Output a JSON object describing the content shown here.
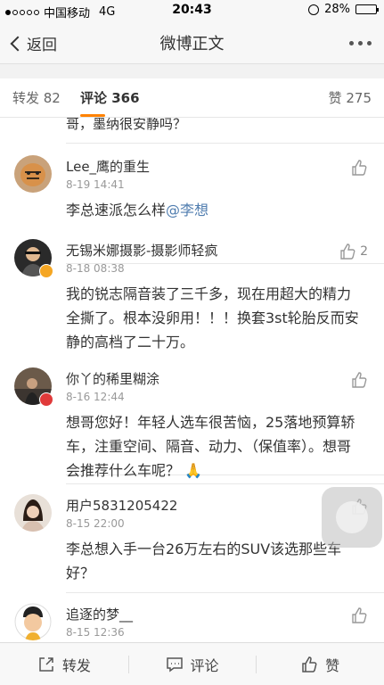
{
  "status_bar": {
    "carrier": "中国移动",
    "network": "4G",
    "time": "20:43",
    "battery": "28%",
    "battery_level": 0.28
  },
  "nav": {
    "back_label": "返回",
    "title": "微博正文"
  },
  "tabs": {
    "repost": "转发 82",
    "comment": "评论 366",
    "like": "赞 275"
  },
  "partial_comment_text": "哥，墨纳很安静吗？",
  "comments": [
    {
      "name": "Lee_鹰的重生",
      "time": "8-19 14:41",
      "text_before": "李总速派怎么样",
      "mention": "@李想",
      "likes": ""
    },
    {
      "name": "无锡米娜摄影-摄影师轻疯",
      "time": "8-18 08:38",
      "text": "我的锐志隔音装了三千多，现在用超大的精力全撕了。根本没卵用！！！换套3st轮胎反而安静的高档了二十万。",
      "likes": "2"
    },
    {
      "name": "你丫的稀里糊涂",
      "time": "8-16 12:44",
      "text": "想哥您好！年轻人选车很苦恼，25落地预算轿车，注重空间、隔音、动力、（保值率）。想哥会推荐什么车呢？",
      "emoji": "🙏",
      "likes": ""
    },
    {
      "name": "用户5831205422",
      "time": "8-15 22:00",
      "text": "李总想入手一台26万左右的SUV该选那些车好？",
      "likes": ""
    },
    {
      "name": "追逐的梦__",
      "time": "8-15 12:36",
      "text": "",
      "likes": ""
    }
  ],
  "bottom_bar": {
    "repost": "转发",
    "comment": "评论",
    "like": "赞"
  },
  "colors": {
    "accent": "#ff8200",
    "mention": "#507daf"
  }
}
